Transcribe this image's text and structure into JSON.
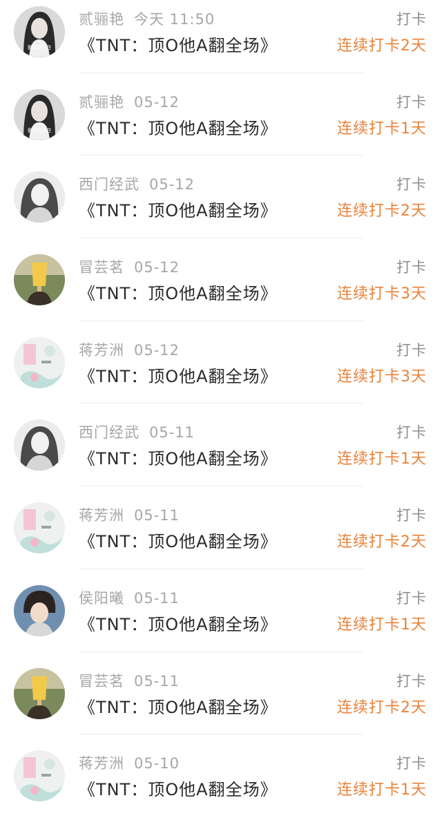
{
  "colors": {
    "accent": "#e8823a",
    "meta_text": "#a6a6a6",
    "title_text": "#2b2b2b"
  },
  "checkins": [
    {
      "user": "贰骊艳",
      "date": "今天 11:50",
      "title": "《TNT：顶O他A翻全场》",
      "action": "打卡",
      "streak": "连续打卡2天",
      "avatar": "portrait-dark-hair",
      "avatar_caption": "爱情靠不住"
    },
    {
      "user": "贰骊艳",
      "date": "05-12",
      "title": "《TNT：顶O他A翻全场》",
      "action": "打卡",
      "streak": "连续打卡1天",
      "avatar": "portrait-dark-hair",
      "avatar_caption": "爱情靠不住"
    },
    {
      "user": "西门经武",
      "date": "05-12",
      "title": "《TNT：顶O他A翻全场》",
      "action": "打卡",
      "streak": "连续打卡2天",
      "avatar": "portrait-grayscale-woman"
    },
    {
      "user": "冒芸茗",
      "date": "05-12",
      "title": "《TNT：顶O他A翻全场》",
      "action": "打卡",
      "streak": "连续打卡3天",
      "avatar": "popsicle-photo"
    },
    {
      "user": "蒋芳洲",
      "date": "05-12",
      "title": "《TNT：顶O他A翻全场》",
      "action": "打卡",
      "streak": "连续打卡3天",
      "avatar": "pastel-illustration"
    },
    {
      "user": "西门经武",
      "date": "05-11",
      "title": "《TNT：顶O他A翻全场》",
      "action": "打卡",
      "streak": "连续打卡1天",
      "avatar": "portrait-grayscale-woman"
    },
    {
      "user": "蒋芳洲",
      "date": "05-11",
      "title": "《TNT：顶O他A翻全场》",
      "action": "打卡",
      "streak": "连续打卡2天",
      "avatar": "pastel-illustration"
    },
    {
      "user": "侯阳曦",
      "date": "05-11",
      "title": "《TNT：顶O他A翻全场》",
      "action": "打卡",
      "streak": "连续打卡1天",
      "avatar": "portrait-young-man"
    },
    {
      "user": "冒芸茗",
      "date": "05-11",
      "title": "《TNT：顶O他A翻全场》",
      "action": "打卡",
      "streak": "连续打卡2天",
      "avatar": "popsicle-photo"
    },
    {
      "user": "蒋芳洲",
      "date": "05-10",
      "title": "《TNT：顶O他A翻全场》",
      "action": "打卡",
      "streak": "连续打卡1天",
      "avatar": "pastel-illustration"
    }
  ]
}
